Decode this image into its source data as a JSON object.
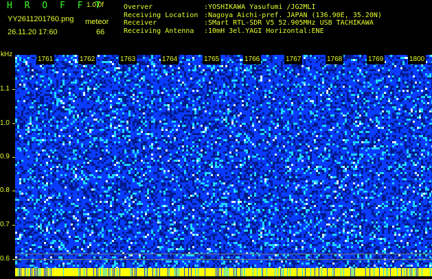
{
  "header": {
    "app_title": "H R O F F T",
    "version": "1.0.0f",
    "filename": "YY2611201760.png",
    "mode": "meteor",
    "datetime": "26.11.20 17:60",
    "count": "66"
  },
  "info": [
    {
      "key": "Overver",
      "value": ":YOSHIKAWA Yasufumi /JG2MLI"
    },
    {
      "key": "Receiving Location",
      "value": ":Nagoya Aichi-pref. JAPAN (136.90E, 35.20N)"
    },
    {
      "key": "Receiver",
      "value": ":SMart RTL-SDR V5 52.905MHz USB TACHIKAWA"
    },
    {
      "key": "Receiving Antenna",
      "value": ":10mH 3el.YAGI Horizontal:ENE"
    }
  ],
  "y_axis": {
    "unit": "kHz",
    "ticks": [
      "1.1",
      "1.0",
      "0.9",
      "0.8",
      "0.7",
      "0.6"
    ]
  },
  "time_marks": [
    "1761",
    "1762",
    "1763",
    "1764",
    "1765",
    "1766",
    "1767",
    "1768",
    "1769",
    "1800"
  ],
  "colors": {
    "background": "#000000",
    "text": "#e6ff2a",
    "title": "#39ff2a",
    "noise_dark": "#001a8a",
    "noise_mid": "#0a3cff",
    "noise_bright": "#1fd8ff",
    "noise_peak": "#d8ffff",
    "strip": "#ffff00"
  }
}
